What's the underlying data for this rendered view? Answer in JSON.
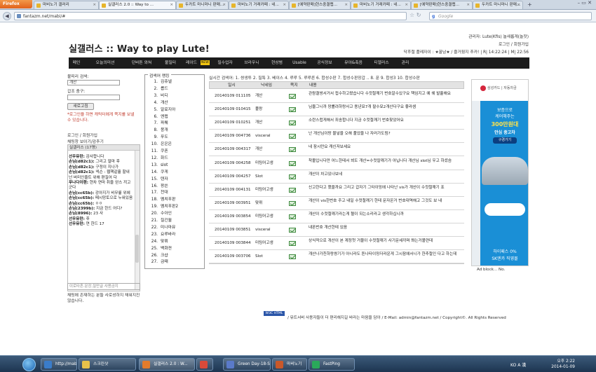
{
  "browser": {
    "menu_label": "Firefox",
    "tabs": [
      {
        "label": "마비노기 갤러리",
        "active": false
      },
      {
        "label": "실갤러스 2.0 :: Way to ...",
        "active": true
      },
      {
        "label": "두카트 마니마니 판매...",
        "active": false
      },
      {
        "label": "마비노기 거래카페 : 네...",
        "active": false
      },
      {
        "label": "[예약판매]현스중결랩...",
        "active": false
      },
      {
        "label": "마비노기 거래카페 : 네...",
        "active": false
      },
      {
        "label": "[예약판매]현스중결랩...",
        "active": false
      },
      {
        "label": "두카트 마니마니 판매...",
        "active": false
      }
    ],
    "url": "fantazm.net/mabi/#",
    "search_placeholder": "Google"
  },
  "site": {
    "logo": "실갤러스 :: Way to play Lute!",
    "top_links": {
      "line1": "관리자: Lute(Kfis) 놀새롭게(놀잣)",
      "line2": "로그인 / 회원가입",
      "line3": "닥후절 플레자이 : ★꿀남★ / 즐거웠지 추카! | R| 14:22:24 | M| 22:56"
    },
    "menu": [
      "메인",
      "오늘의미션",
      "던바튼 와쳐",
      "불필터",
      "레이드",
      "필수업자",
      "브라우니",
      "현상범",
      "Usable",
      "공식정보",
      "뮤야&축음",
      "티엘러스",
      "관리"
    ],
    "menu_new_badge": "NEW"
  },
  "sidebar": {
    "char_search_label": "불피리 검색:",
    "char_search_value": "개산",
    "peek_label": "갑조 충구:",
    "refresh_button": "새로고침",
    "notice": "*로그인을 하면 캐릭터에게 쪽지를 보낼 수 있습니다.",
    "login_link": "로그인 / 회원가입",
    "chat_toggle": "채팅창 보이기/감추기",
    "chat_title": "실갤러스 (17명)",
    "chat_lines": [
      {
        "name": "선우뮤란:",
        "msg": " 감사합니다"
      },
      {
        "name": "손님(d82c1):",
        "msg": " 그리고 얼마 후"
      },
      {
        "name": "손님(d82c1):",
        "msg": " 구정이 지나가"
      },
      {
        "name": "손님(d82c1):",
        "msg": " 넥슨 : 웹핵같흘 할내 넌 버미인줄트 위해 편질어 다"
      },
      {
        "name": "푸나다이랜:",
        "msg": " 현차 연마 취을 얻스 끼고군다"
      },
      {
        "name": "손님(cc65b):",
        "msg": " 강아지가 비무릎 위에"
      },
      {
        "name": "손님(cc65b):",
        "msg": " 페시망토으로 누워있음"
      },
      {
        "name": "손님(cc65b):",
        "msg": " ㅇㅇ"
      },
      {
        "name": "손님(2399b):",
        "msg": " 지금 한드 어디?"
      },
      {
        "name": "손님(8996):",
        "msg": " 23 사"
      },
      {
        "name": "선우뮤란:",
        "msg": " 후"
      },
      {
        "name": "선우뮤란:",
        "msg": " 연 한드 17"
      }
    ],
    "chat_input_placeholder": "이로타혼.문장,질만글 사용금지",
    "chat_footer": "채팅에 존재하는 분들 사로성하지 채워지진 않습니다."
  },
  "ranking": {
    "title": "검색어 랭킹",
    "items": [
      "김쥬넬",
      "룹드",
      "비디",
      "개산",
      "알료지아",
      "엔맵",
      "파퀘",
      "붕개",
      "푸도",
      "은은은",
      "쿠폰",
      "화드",
      "slot",
      "쿠게",
      "텐자",
      "팡쓴",
      "천대",
      "멤치푸판",
      "멤치푸판2",
      "수아인",
      "칠긴월",
      "미나마뮤",
      "요루바라",
      "맞뤼",
      "백화젼",
      "크샵",
      "금때"
    ]
  },
  "realtime": {
    "text": "실시간 검색어: 1. 쌍생투 2. 필특 3. 베이스 4. 루루 5. 루루른 6. 합성수판 7. 합성수판장갑 .. 8. 푼 9. 합성3 10. 합성수판"
  },
  "table": {
    "headers": [
      "일시",
      "닉네임",
      "쪽지",
      "내용"
    ],
    "rows": [
      {
        "date": "20140109 011105",
        "nick": "개산",
        "content": "관람결쌍서거서 접수하고왔습니다 수컷절깨기 번호알수있구요 책임지고 예 쉐 발흘해요"
      },
      {
        "date": "20140109 010415",
        "nick": "풀랑",
        "content": "님뮬그니까 망률려하랑사고 용년묘7개 팔수묘2개산다구요 좋라셈"
      },
      {
        "date": "20140109 010251",
        "nick": "개산",
        "content": "소란스럽게해서 죄송합니다 지금 수컷절깨기 번호찾았어요"
      },
      {
        "date": "20140109 004736",
        "nick": "visceral",
        "content": "난 개산님이랑 물넣을 오해 풀었을 나 자러가도됨?"
      },
      {
        "date": "20140109 004317",
        "nick": "개산",
        "content": "네 잠시만요 캐신저보세요"
      },
      {
        "date": "20140109 004258",
        "nick": "미팅어고생",
        "content": "착볼입니다만 어느한테서 뵈도 개산=수컷칼깨기가 아닙니다 개산님 slot님 우고 하셨슴"
      },
      {
        "date": "20140109 004257",
        "nick": "Slot",
        "content": "개산이 차고있나보네"
      },
      {
        "date": "20140109 004131",
        "nick": "미팅어고생",
        "content": "신고한다고 했을까요 그리고 갑자기 그타이밍에 나타난 vis가 개산이 수컷절깨기 죠"
      },
      {
        "date": "20140109 003951",
        "nick": "맞뤼",
        "content": "개산이 vis한번호 주고 내일 수컷절깨기 한테 문자온거 번호대역해고 그것도 보 내"
      },
      {
        "date": "20140109 003854",
        "nick": "미팅어고생",
        "content": "개산이 수컷절깨기라는게 혈이 되는소리라고 생각하십니까"
      },
      {
        "date": "20140109 003851",
        "nick": "visceral",
        "content": "내폰번호 개산한테 있음"
      },
      {
        "date": "20140109 003844",
        "nick": "미팅어고생",
        "content": "상식적으로 개산이 본 계정첫 거물이 수컷절깨기 사기문세끼며 쫘는거볼련데"
      },
      {
        "date": "20140109 003706",
        "nick": "Slot",
        "content": "개산나가친하랑쌍기가 아니라도 튼나타이밍더라운게 그시잠에서니가 한추절인 다고 하는데"
      }
    ]
  },
  "ad": {
    "brand": "삼성카드 | 자동차금",
    "line1": "보증으로",
    "line2": "케어해주는",
    "price": "300만원대",
    "line3": "안심 중고차",
    "button": "구경가기",
    "foot1": "하이패스 0%",
    "foot2": "SK엔카 직영몰",
    "blocker": "Ad block... No."
  },
  "footer": {
    "badge": "W3C HTML 4.01",
    "text": "/ 뮤트서버 사용자들이 더 편리해지길 바라는 마음을 담아 / E-Mail: admin@fantazm.net / Copyright©. All Rights Reserved"
  },
  "taskbar": {
    "items": [
      {
        "label": "http://mabinogi...",
        "color": "#3a7cc9"
      },
      {
        "label": "스크린샷",
        "color": "#e8c24a"
      },
      {
        "label": "실갤러스 2.0 : W...",
        "color": "#e27b2b",
        "active": true
      },
      {
        "label": "",
        "color": "#d84a3a"
      },
      {
        "label": "Green Day-18-S...",
        "color": "#5a7ac9"
      },
      {
        "label": "마비노기",
        "color": "#c9582a"
      },
      {
        "label": "FastPing",
        "color": "#2aa85a"
      }
    ],
    "tray": "KO  A 漢",
    "time": "오후 2:22",
    "date": "2014-01-09"
  }
}
